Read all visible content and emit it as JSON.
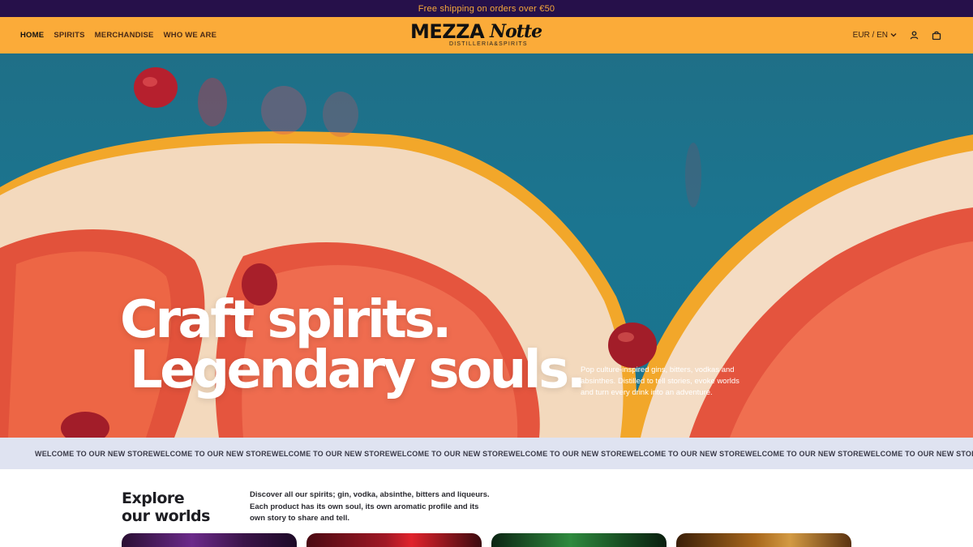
{
  "announcement": "Free shipping on orders over €50",
  "nav": {
    "items": [
      "HOME",
      "SPIRITS",
      "MERCHANDISE",
      "WHO WE ARE"
    ],
    "active_index": 0
  },
  "logo": {
    "main": "MEZZA",
    "script": "Notte",
    "subtitle": "DISTILLERIA&SPIRITS"
  },
  "header_right": {
    "locale": "EUR / EN",
    "icons": [
      "chevron-down-icon",
      "user-icon",
      "bag-icon"
    ]
  },
  "hero": {
    "headline_line1": "Craft spirits.",
    "headline_line2": "Legendary souls.",
    "description": "Pop culture-inspired gins, bitters, vodkas and absinthes. Distilled to tell stories, evoke worlds and turn every drink into an adventure."
  },
  "marquee": {
    "items": [
      "WELCOME TO OUR NEW STORE",
      "WELCOME TO OUR NEW STORE",
      "WELCOME TO OUR NEW STORE",
      "WELCOME TO OUR NEW STORE",
      "WELCOME TO OUR NEW STORE",
      "WELCOME TO OUR NEW STORE",
      "WELCOME TO OUR NEW STORE",
      "WELCOME TO OUR NEW STORE"
    ]
  },
  "explore": {
    "title_line1": "Explore",
    "title_line2": "our worlds",
    "description": "Discover all our spirits; gin, vodka, absinthe, bitters and liqueurs. Each product has its own soul, its own aromatic profile and its own story to share and tell."
  },
  "colors": {
    "announce_bg": "#26104a",
    "announce_text": "#f7a93a",
    "header_bg": "#fbab39",
    "hero_bg": "#1b7590",
    "marquee_bg": "#dfe3f1"
  }
}
